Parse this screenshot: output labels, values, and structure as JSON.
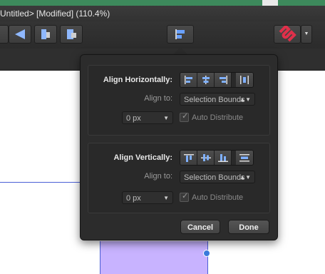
{
  "window": {
    "title": "Untitled> [Modified] (110.4%)"
  },
  "toolbar": {
    "buttons": [
      "flip-horizontal-icon",
      "arrange-back-icon",
      "arrange-front-icon",
      "alignment-icon",
      "snapping-magnet-icon"
    ]
  },
  "popover": {
    "horizontal": {
      "label": "Align Horizontally:",
      "align_to_label": "Align to:",
      "align_to_value": "Selection Bounds",
      "spacing_value": "0 px",
      "auto_distribute_label": "Auto Distribute",
      "auto_distribute_checked": true,
      "icons": [
        "align-left-icon",
        "align-center-icon",
        "align-right-icon",
        "distribute-horizontal-icon"
      ]
    },
    "vertical": {
      "label": "Align Vertically:",
      "align_to_label": "Align to:",
      "align_to_value": "Selection Bounds",
      "spacing_value": "0 px",
      "auto_distribute_label": "Auto Distribute",
      "auto_distribute_checked": true,
      "icons": [
        "align-top-icon",
        "align-middle-icon",
        "align-bottom-icon",
        "distribute-vertical-icon"
      ]
    },
    "cancel_label": "Cancel",
    "done_label": "Done"
  },
  "colors": {
    "accent": "#3a7bdc",
    "selection": "#c8b3ff",
    "magnet": "#e0304a"
  }
}
